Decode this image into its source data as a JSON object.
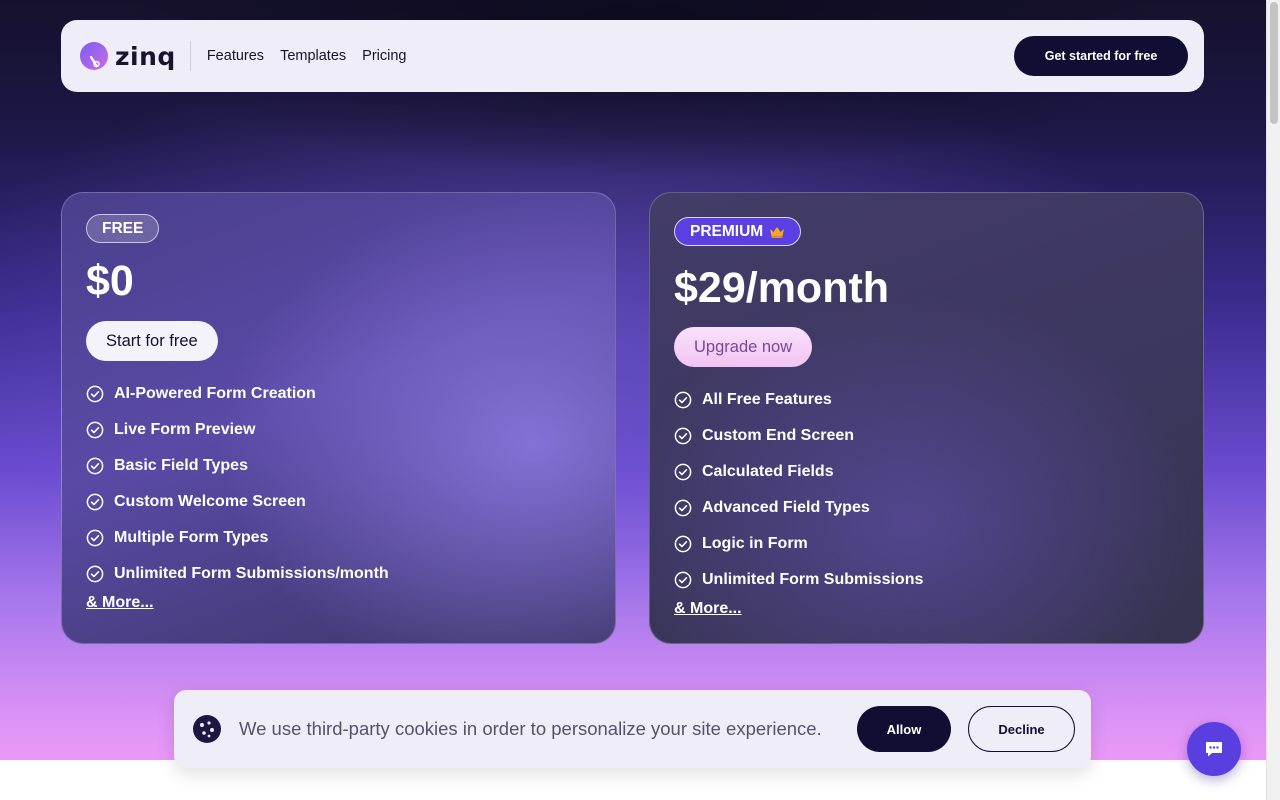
{
  "header": {
    "logo_text": "zinq",
    "nav": [
      "Features",
      "Templates",
      "Pricing"
    ],
    "cta": "Get started for free"
  },
  "plans": {
    "free": {
      "badge": "FREE",
      "price": "$0",
      "button": "Start for free",
      "features": [
        "AI-Powered Form Creation",
        "Live Form Preview",
        "Basic Field Types",
        "Custom Welcome Screen",
        "Multiple Form Types",
        "Unlimited Form Submissions/month"
      ],
      "more": "& More..."
    },
    "premium": {
      "badge": "PREMIUM",
      "price": "$29/month",
      "button": "Upgrade now",
      "features": [
        "All Free Features",
        "Custom End Screen",
        "Calculated Fields",
        "Advanced Field Types",
        "Logic in Form",
        "Unlimited Form Submissions"
      ],
      "more": "& More..."
    }
  },
  "cookie_banner": {
    "text": "We use third-party cookies in order to personalize your site experience.",
    "allow": "Allow",
    "decline": "Decline"
  },
  "icons": {
    "logo": "zinq-logo-icon",
    "check": "check-circle-icon",
    "crown": "crown-icon",
    "cookie": "cookie-icon",
    "chat": "chat-bubble-icon"
  },
  "colors": {
    "brand_dark": "#120d33",
    "accent_purple": "#5b3fe0",
    "crown": "#f5a623"
  }
}
